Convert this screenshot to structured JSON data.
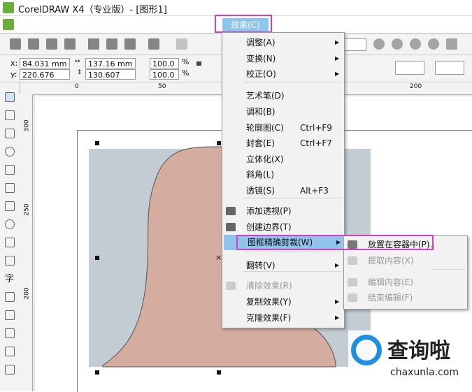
{
  "window": {
    "title": "CorelDRAW X4（专业版）- [图形1]"
  },
  "menubar": {
    "effect_label": "效果(C)"
  },
  "propbar": {
    "x_label": "x:",
    "x": "84.031 mm",
    "y_label": "y:",
    "y": "220.676 mm",
    "width": "137.16 mm",
    "height": "130.607 mm",
    "scale_x": "100.0",
    "scale_y": "100.0",
    "pct": "%"
  },
  "ruler": {
    "h_ticks": [
      "0",
      "50",
      "200"
    ],
    "v_ticks": [
      "300",
      "250",
      "200"
    ]
  },
  "menu": {
    "items": [
      {
        "label": "调整(A)",
        "shortcut": "",
        "submenu": true,
        "disabled": false
      },
      {
        "label": "变换(N)",
        "shortcut": "",
        "submenu": true,
        "disabled": false
      },
      {
        "label": "校正(O)",
        "shortcut": "",
        "submenu": true,
        "disabled": false
      },
      {
        "label": "艺术笔(D)",
        "shortcut": "",
        "submenu": false,
        "disabled": false
      },
      {
        "label": "调和(B)",
        "shortcut": "",
        "submenu": false,
        "disabled": false
      },
      {
        "label": "轮廓图(C)",
        "shortcut": "Ctrl+F9",
        "submenu": false,
        "disabled": false
      },
      {
        "label": "封套(E)",
        "shortcut": "Ctrl+F7",
        "submenu": false,
        "disabled": false
      },
      {
        "label": "立体化(X)",
        "shortcut": "",
        "submenu": false,
        "disabled": false
      },
      {
        "label": "斜角(L)",
        "shortcut": "",
        "submenu": false,
        "disabled": false
      },
      {
        "label": "透镜(S)",
        "shortcut": "Alt+F3",
        "submenu": false,
        "disabled": false
      },
      {
        "label": "添加透视(P)",
        "shortcut": "",
        "submenu": false,
        "disabled": false
      },
      {
        "label": "创建边界(T)",
        "shortcut": "",
        "submenu": false,
        "disabled": false
      },
      {
        "label": "图框精确剪裁(W)",
        "shortcut": "",
        "submenu": true,
        "disabled": false
      },
      {
        "label": "翻转(V)",
        "shortcut": "",
        "submenu": true,
        "disabled": false
      },
      {
        "label": "清除效果(R)",
        "shortcut": "",
        "submenu": false,
        "disabled": true
      },
      {
        "label": "复制效果(Y)",
        "shortcut": "",
        "submenu": true,
        "disabled": false
      },
      {
        "label": "克隆效果(F)",
        "shortcut": "",
        "submenu": true,
        "disabled": false
      }
    ]
  },
  "submenu": {
    "items": [
      {
        "label": "放置在容器中(P)..",
        "disabled": false
      },
      {
        "label": "提取内容(X)",
        "disabled": true
      },
      {
        "label": "编辑内容(E)",
        "disabled": true
      },
      {
        "label": "结束编辑(F)",
        "disabled": true
      }
    ]
  },
  "watermark": {
    "brand": "查询啦",
    "url": "chaxunla.com"
  },
  "colors": {
    "highlight": "#d43fd0",
    "menu_selected": "#90c2ea",
    "image_bg": "#c3ccd3",
    "shape_fill": "#d4ada0"
  }
}
